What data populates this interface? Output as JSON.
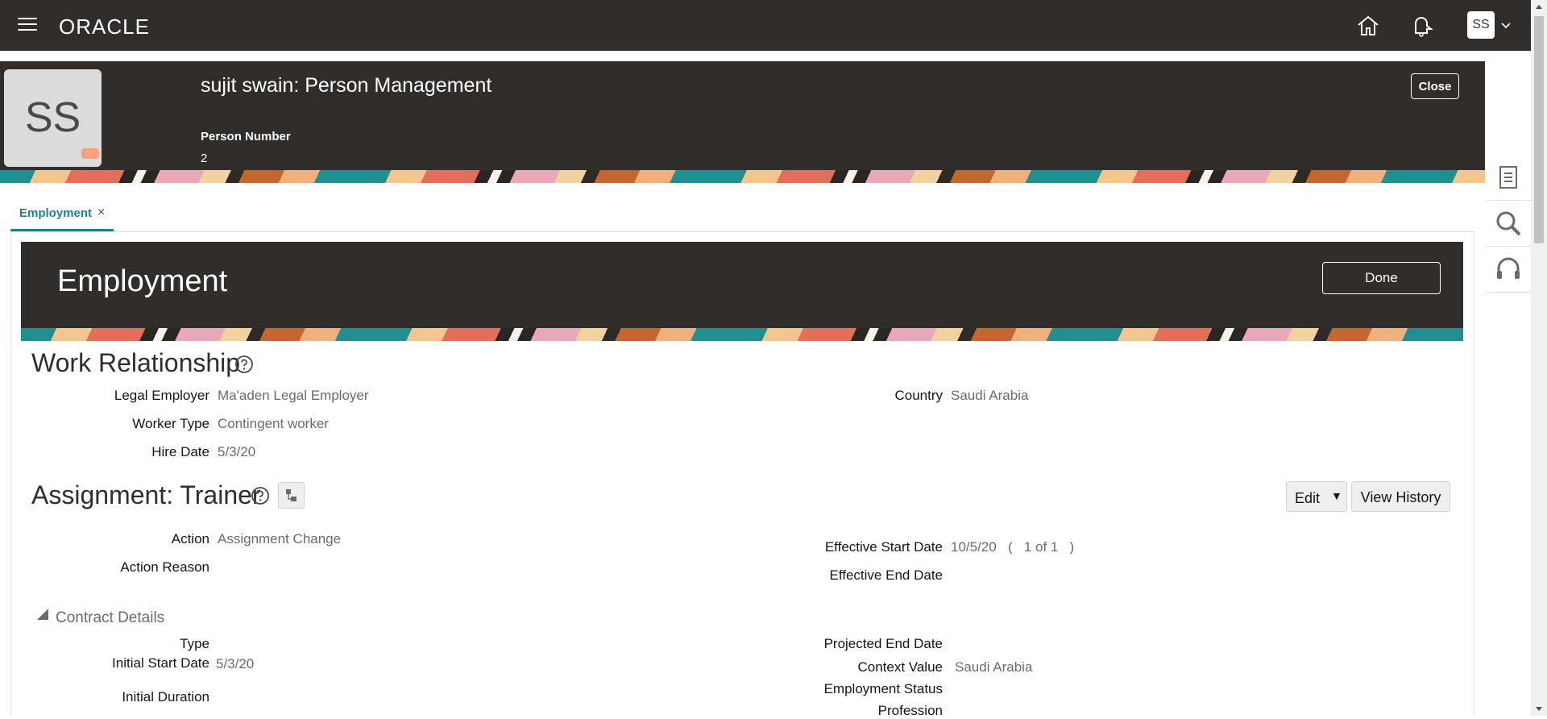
{
  "header": {
    "logo": "ORACLE",
    "user_initials": "SS"
  },
  "person": {
    "avatar_initials": "SS",
    "avatar_badge": "···",
    "title": "sujit swain: Person Management",
    "person_number_label": "Person Number",
    "person_number": "2",
    "close_label": "Close"
  },
  "tabs": [
    {
      "label": "Employment",
      "close": "×"
    }
  ],
  "employment": {
    "title": "Employment",
    "done_label": "Done"
  },
  "work_relationship": {
    "heading": "Work Relationship",
    "legal_employer_label": "Legal Employer",
    "legal_employer": "Ma'aden Legal Employer",
    "worker_type_label": "Worker Type",
    "worker_type": "Contingent worker",
    "hire_date_label": "Hire Date",
    "hire_date": "5/3/20",
    "country_label": "Country",
    "country": "Saudi Arabia"
  },
  "assignment": {
    "heading": "Assignment: Trainer",
    "edit_label": "Edit",
    "view_history_label": "View History",
    "action_label": "Action",
    "action": "Assignment Change",
    "action_reason_label": "Action Reason",
    "effective_start_label": "Effective Start Date",
    "effective_start": "10/5/20",
    "record_nav": "(   1 of 1   )",
    "effective_end_label": "Effective End Date"
  },
  "contract": {
    "heading": "Contract Details",
    "type_label": "Type",
    "initial_start_label": "Initial Start Date",
    "initial_start": "5/3/20",
    "initial_duration_label": "Initial Duration",
    "projected_end_label": "Projected End Date",
    "context_value_label": "Context Value",
    "context_value": "Saudi Arabia",
    "employment_status_label": "Employment Status",
    "profession_label": "Profession"
  }
}
